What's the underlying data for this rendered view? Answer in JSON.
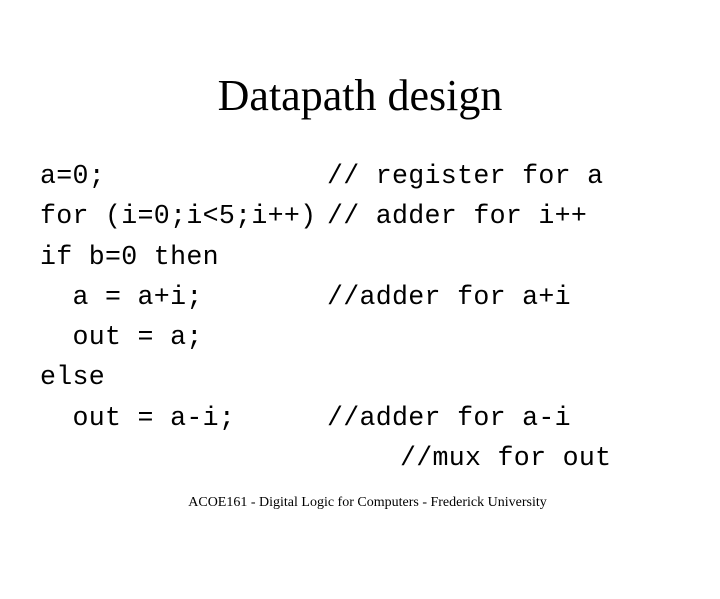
{
  "slide": {
    "title": "Datapath design",
    "code_lines": [
      {
        "code": "a=0;",
        "comment": "// register for a"
      },
      {
        "code": "for (i=0;i<5;i++)",
        "comment": "// adder for i++"
      },
      {
        "code": "if b=0 then",
        "comment": ""
      },
      {
        "code": "  a = a+i;",
        "comment": "//adder for a+i"
      },
      {
        "code": "  out = a;",
        "comment": ""
      },
      {
        "code": "else",
        "comment": ""
      },
      {
        "code": "  out = a-i;",
        "comment": "//adder for a-i"
      },
      {
        "code": "",
        "comment": "//mux for out"
      }
    ],
    "footer": "ACOE161 - Digital Logic for Computers - Frederick University"
  }
}
